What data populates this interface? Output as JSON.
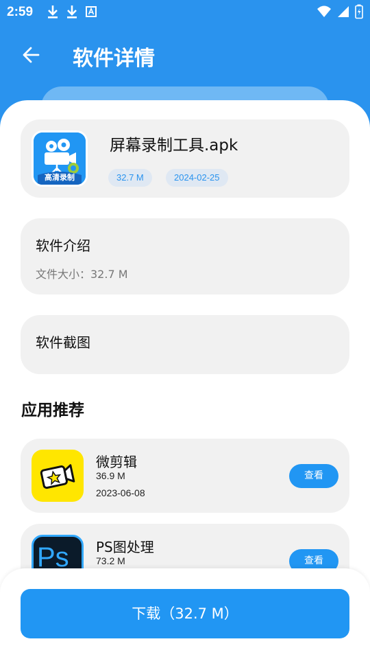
{
  "status_bar": {
    "time": "2:59"
  },
  "header": {
    "title": "软件详情"
  },
  "app": {
    "name": "屏幕录制工具.apk",
    "size_tag": "32.7 M",
    "date_tag": "2024-02-25",
    "icon_caption": "高清录制"
  },
  "intro": {
    "title": "软件介绍",
    "file_size_text": "文件大小：32.7 M"
  },
  "screenshots": {
    "title": "软件截图"
  },
  "recommend": {
    "title": "应用推荐",
    "items": [
      {
        "name": "微剪辑",
        "size": "36.9 M",
        "date": "2023-06-08",
        "button": "查看"
      },
      {
        "name": "PS图处理",
        "size": "73.2 M",
        "date": "",
        "button": "查看"
      }
    ],
    "ps_icon_text": "Ps"
  },
  "download": {
    "label": "下载（32.7 M）"
  },
  "colors": {
    "primary": "#2196f3",
    "header": "#2a93ee",
    "card": "#f1f1f1"
  }
}
